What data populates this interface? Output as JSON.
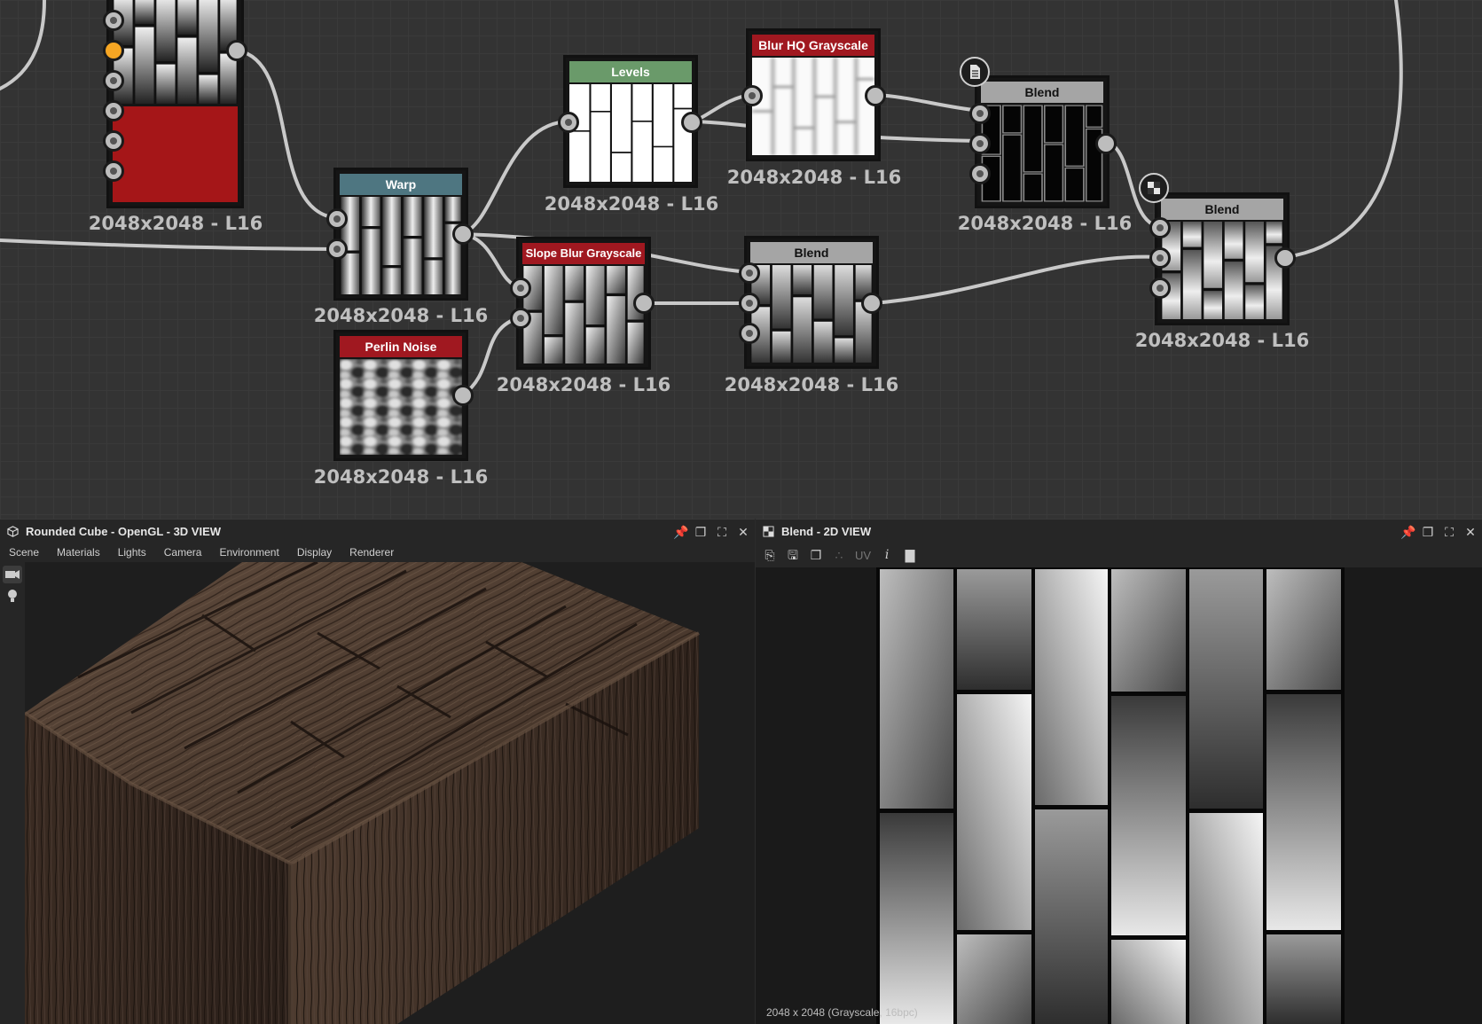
{
  "graph": {
    "resolution_label": "2048x2048 - L16",
    "nodes": {
      "tile": {
        "title": ""
      },
      "warp": {
        "title": "Warp",
        "color": "#4e7681"
      },
      "perlin": {
        "title": "Perlin Noise",
        "color": "#a01820"
      },
      "slope": {
        "title": "Slope Blur Grayscale",
        "color": "#a01820"
      },
      "levels": {
        "title": "Levels",
        "color": "#6a9a6a"
      },
      "blurhq": {
        "title": "Blur HQ Grayscale",
        "color": "#a01820"
      },
      "blend_a": {
        "title": "Blend",
        "color": "#a5a5a5"
      },
      "blend_b": {
        "title": "Blend",
        "color": "#a5a5a5"
      },
      "blend_c": {
        "title": "Blend",
        "color": "#a5a5a5"
      }
    }
  },
  "view3d": {
    "title": "Rounded Cube - OpenGL - 3D VIEW",
    "menu": [
      "Scene",
      "Materials",
      "Lights",
      "Camera",
      "Environment",
      "Display",
      "Renderer"
    ]
  },
  "view2d": {
    "title": "Blend - 2D VIEW",
    "uv_label": "UV",
    "info_label": "i",
    "status": "2048 x 2048 (Grayscale, 16bpc)"
  },
  "icons": {
    "panel_controls": [
      "pin-icon",
      "float-icon",
      "maximize-icon",
      "close-icon"
    ]
  }
}
